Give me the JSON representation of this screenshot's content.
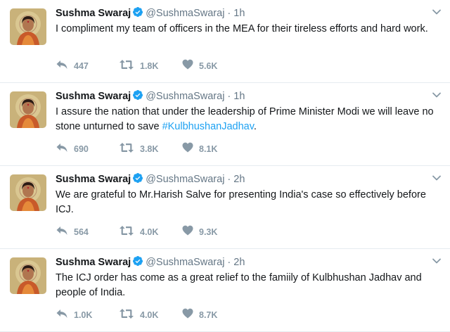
{
  "colors": {
    "name": "#14171a",
    "secondary": "#657786",
    "action_gray": "#8899a6",
    "link": "#1da1f2",
    "verified": "#1da1f2",
    "divider": "#e6ecf0"
  },
  "icons": {
    "reply": "reply-icon",
    "retweet": "retweet-icon",
    "like": "heart-icon",
    "verified": "verified-badge-icon",
    "menu": "chevron-down-icon"
  },
  "tweets": [
    {
      "name": "Sushma Swaraj",
      "handle": "@SushmaSwaraj",
      "separator": "·",
      "time": "1h",
      "text_parts": [
        {
          "text": "I compliment my team of officers in the MEA for their tireless efforts and hard work.",
          "link": false
        }
      ],
      "replies": "447",
      "retweets": "1.8K",
      "likes": "5.6K"
    },
    {
      "name": "Sushma Swaraj",
      "handle": "@SushmaSwaraj",
      "separator": "·",
      "time": "1h",
      "text_parts": [
        {
          "text": "I assure the nation that under the leadership of Prime Minister Modi we will leave no stone unturned to save ",
          "link": false
        },
        {
          "text": "#KulbhushanJadhav",
          "link": true
        },
        {
          "text": ".",
          "link": false
        }
      ],
      "replies": "690",
      "retweets": "3.8K",
      "likes": "8.1K"
    },
    {
      "name": "Sushma Swaraj",
      "handle": "@SushmaSwaraj",
      "separator": "·",
      "time": "2h",
      "text_parts": [
        {
          "text": "We are grateful to Mr.Harish Salve for presenting India's case so effectively before ICJ.",
          "link": false
        }
      ],
      "replies": "564",
      "retweets": "4.0K",
      "likes": "9.3K"
    },
    {
      "name": "Sushma Swaraj",
      "handle": "@SushmaSwaraj",
      "separator": "·",
      "time": "2h",
      "text_parts": [
        {
          "text": "The ICJ order has come as a great relief to the famiily of Kulbhushan Jadhav and people of India.",
          "link": false
        }
      ],
      "replies": "1.0K",
      "retweets": "4.0K",
      "likes": "8.7K"
    }
  ]
}
